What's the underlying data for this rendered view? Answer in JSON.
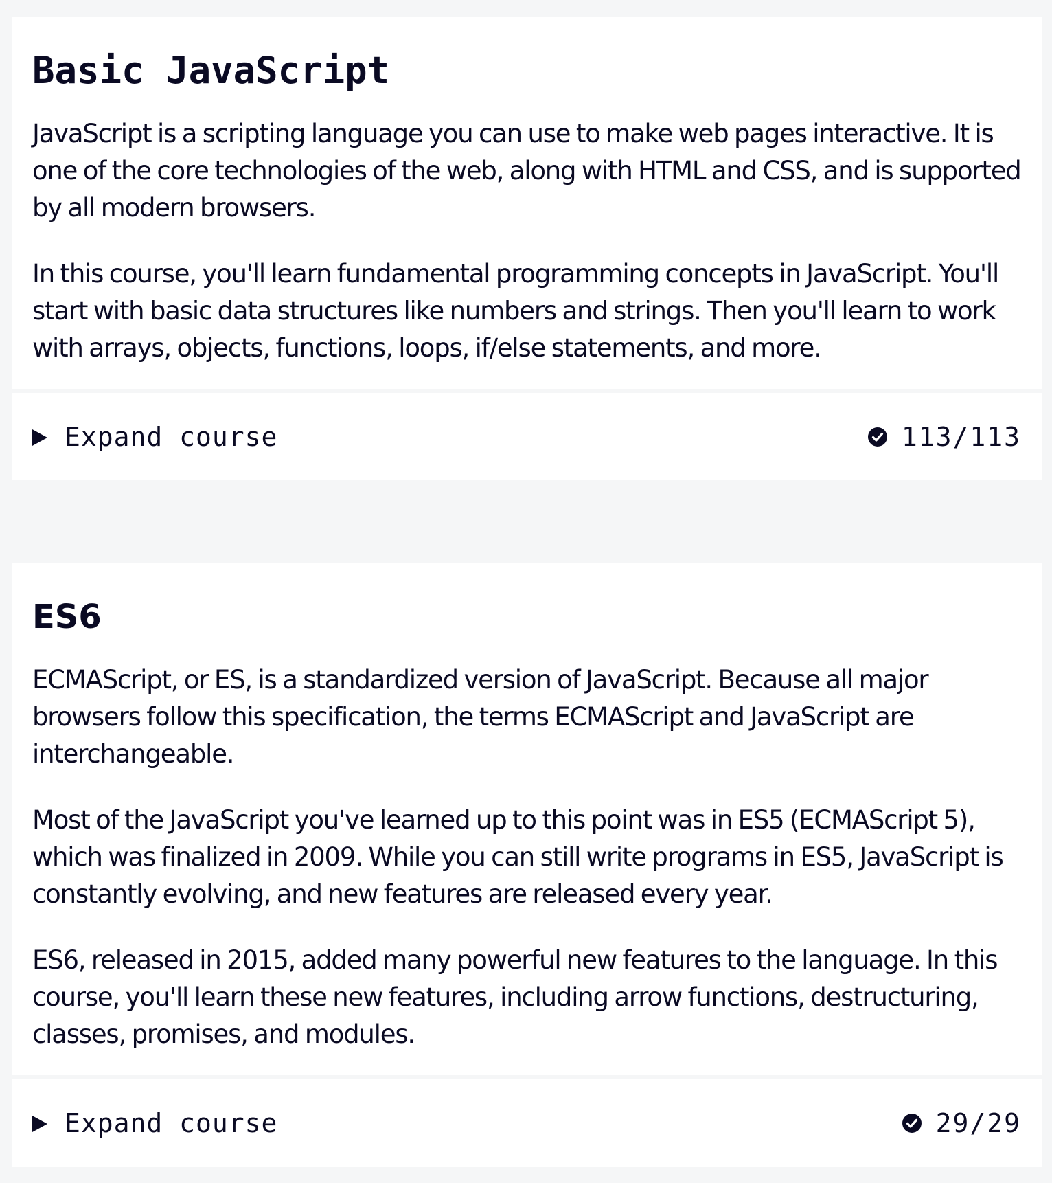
{
  "courses": [
    {
      "title": "Basic JavaScript",
      "paragraphs": [
        "JavaScript is a scripting language you can use to make web pages interactive. It is one of the core technologies of the web, along with HTML and CSS, and is supported by all modern browsers.",
        "In this course, you'll learn fundamental programming concepts in JavaScript. You'll start with basic data structures like numbers and strings. Then you'll learn to work with arrays, objects, functions, loops, if/else statements, and more."
      ],
      "expand_label": "Expand course",
      "progress": "113/113"
    },
    {
      "title": "ES6",
      "paragraphs": [
        "ECMAScript, or ES, is a standardized version of JavaScript. Because all major browsers follow this specification, the terms ECMAScript and JavaScript are interchangeable.",
        "Most of the JavaScript you've learned up to this point was in ES5 (ECMAScript 5), which was finalized in 2009. While you can still write programs in ES5, JavaScript is constantly evolving, and new features are released every year.",
        "ES6, released in 2015, added many powerful new features to the language. In this course, you'll learn these new features, including arrow functions, destructuring, classes, promises, and modules."
      ],
      "expand_label": "Expand course",
      "progress": "29/29"
    }
  ],
  "icons": {
    "expand": "caret-right-icon",
    "completed": "check-circle-icon"
  },
  "colors": {
    "background": "#f5f6f7",
    "card": "#ffffff",
    "text": "#0a0a23"
  }
}
